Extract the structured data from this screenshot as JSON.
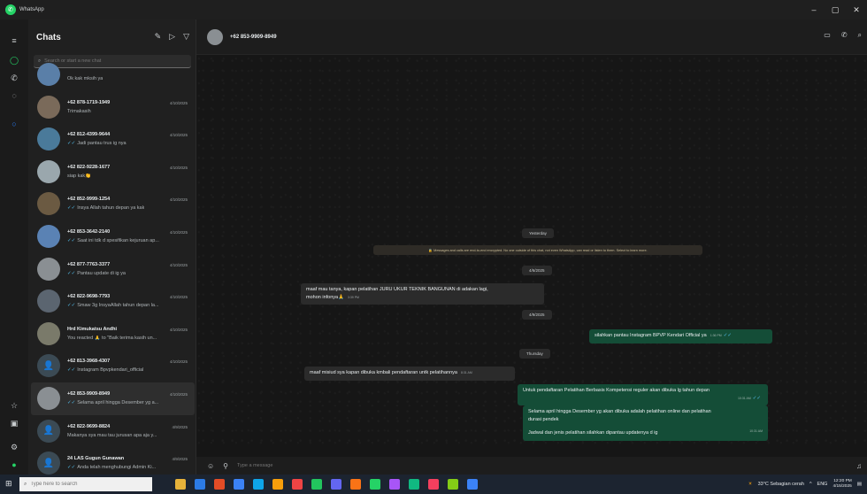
{
  "window": {
    "title": "WhatsApp",
    "controls": [
      "–",
      "▢",
      "✕"
    ]
  },
  "rail": {
    "icons": [
      "menu-icon",
      "chats-icon",
      "calls-icon",
      "status-icon",
      "meta-ai-icon",
      "starred-icon",
      "archived-icon",
      "settings-icon",
      "profile-icon"
    ]
  },
  "sidebar": {
    "title": "Chats",
    "search_placeholder": "Search or start a new chat",
    "chats": [
      {
        "name": "",
        "preview": "Ok kak mksih ya",
        "date": "",
        "ticks": false
      },
      {
        "name": "+62 878-1719-1949",
        "preview": "Trimakasih",
        "date": "4/10/2025",
        "ticks": false
      },
      {
        "name": "+62 812-4399-9644",
        "preview": "Jadi pantau trus ig nya",
        "date": "4/10/2025",
        "ticks": true
      },
      {
        "name": "+62 822-9228-1677",
        "preview": "siap kak👏",
        "date": "4/10/2025",
        "ticks": false
      },
      {
        "name": "+62 852-9999-1254",
        "preview": "Insya Allah tahun depan ya kak",
        "date": "4/10/2025",
        "ticks": true
      },
      {
        "name": "+62 853-3642-2140",
        "preview": "Saat ini tdk d spesifikan kejuruan ap...",
        "date": "4/10/2025",
        "ticks": true
      },
      {
        "name": "+62 877-7763-3377",
        "preview": "Pantau update di ig ya",
        "date": "4/10/2025",
        "ticks": true
      },
      {
        "name": "+62 822-9698-7793",
        "preview": "Smaw 3g InsyaAllah tahun depan la...",
        "date": "4/10/2025",
        "ticks": true
      },
      {
        "name": "Hrd Kimukatsu Andhi",
        "preview": "You reacted 🙏 to \"Baik terima kasih un...",
        "date": "4/10/2025",
        "ticks": false
      },
      {
        "name": "+62 813-3968-4307",
        "preview": "Instagram Bpvpkendari_official",
        "date": "4/10/2025",
        "ticks": true
      },
      {
        "name": "+62 853-9909-8949",
        "preview": "Selama april hingga Desember yg a...",
        "date": "4/10/2025",
        "ticks": true
      },
      {
        "name": "+62 822-9699-8824",
        "preview": "Makanya sya mau tau jurusan apa aja y...",
        "date": "4/9/2025",
        "ticks": false
      },
      {
        "name": "24 LAS Gugun Gunawan",
        "preview": "Anda telah menghubungi Admin Ki...",
        "date": "4/9/2025",
        "ticks": true
      }
    ]
  },
  "conversation": {
    "contact": "+62 853-9909-8949",
    "header_icons": [
      "video-call-icon",
      "voice-call-icon",
      "search-icon"
    ],
    "pills": {
      "yesterday": "Yesterday",
      "date1": "4/6/2025",
      "date2": "4/9/2025",
      "thursday": "Thursday"
    },
    "encryption_notice": "🔒 Messages and calls are end-to-end encrypted. No one outside of this chat, not even WhatsApp, can read or listen to them. Select to learn more.",
    "messages": [
      {
        "dir": "in",
        "lines": [
          "maaf mau tanya, kapan pelatihan JURU UKUR TEKNIK BANGUNAN di adakan lagi,",
          "mohon infonya🙏"
        ],
        "time": "3:39 PM"
      },
      {
        "dir": "out",
        "lines": [
          "silahkan pantau Instagram BPVP Kendari Official ya"
        ],
        "time": "1:36 PM"
      },
      {
        "dir": "in",
        "lines": [
          "maaf misiud sya kapan dibuka kmbali pendaftaran untk pelatihannya"
        ],
        "time": "8:31 AM"
      },
      {
        "dir": "out",
        "lines": [
          "Untuk pendaftaran Pelatihan Berbasis Kompetensi reguler akan dibuka lg tahun depan"
        ],
        "time": "10:31 AM"
      },
      {
        "dir": "out",
        "lines": [
          "Selama april hingga Desember yg akan dibuka adalah pelatihan online dan pelatihan",
          "durasi pendek",
          "",
          "Jadwal dan jenis pelatihan silahkan dipantau updatenya d ig"
        ],
        "time": "10:31 AM"
      }
    ],
    "composer_placeholder": "Type a message"
  },
  "taskbar": {
    "search_placeholder": "Type here to search",
    "weather": "33°C  Sebagian cerah",
    "lang": "ENG",
    "time": "12:20 PM",
    "date": "4/15/2025",
    "app_colors": [
      "#e6b23a",
      "#2c7be5",
      "#e34c26",
      "#3b82f6",
      "#0ea5e9",
      "#f59e0b",
      "#ef4444",
      "#22c55e",
      "#6366f1",
      "#f97316",
      "#25d366",
      "#a855f7",
      "#10b981",
      "#f43f5e",
      "#84cc16",
      "#3b82f6"
    ]
  }
}
